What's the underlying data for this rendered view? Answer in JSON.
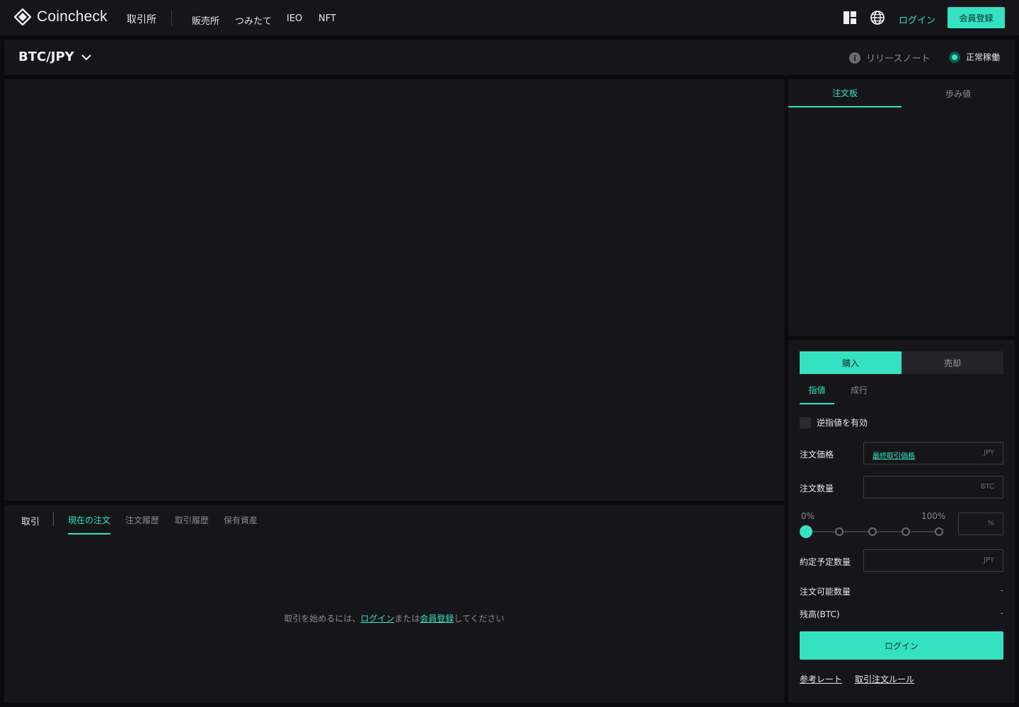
{
  "header": {
    "brand": "Coincheck",
    "main_nav": "取引所",
    "nav_items": [
      "販売所",
      "つみたて",
      "IEO",
      "NFT"
    ],
    "login": "ログイン",
    "register": "会員登録"
  },
  "pairbar": {
    "pair": "BTC/JPY",
    "release_notes": "リリースノート",
    "status": "正常稼働"
  },
  "orderbook": {
    "tabs": [
      "注文板",
      "歩み値"
    ],
    "active_tab": 0
  },
  "bottom": {
    "label": "取引",
    "tabs": [
      "現在の注文",
      "注文履歴",
      "取引履歴",
      "保有資産"
    ],
    "active_tab": 0,
    "message_prefix": "取引を始めるには、",
    "message_login": "ログイン",
    "message_mid": "または",
    "message_register": "会員登録",
    "message_suffix": "してください"
  },
  "order_form": {
    "buy": "購入",
    "sell": "売却",
    "order_types": [
      "指値",
      "成行"
    ],
    "stop_label": "逆指値を有効",
    "price_label": "注文価格",
    "price_link": "最終取引価格",
    "price_unit": "JPY",
    "amount_label": "注文数量",
    "amount_unit": "BTC",
    "pct_min": "0%",
    "pct_max": "100%",
    "pct_unit": "%",
    "pct_value": 0,
    "estimate_label": "約定予定数量",
    "estimate_unit": "JPY",
    "available_label": "注文可能数量",
    "available_value": "-",
    "balance_label": "残高(BTC)",
    "balance_value": "-",
    "login_button": "ログイン",
    "ref_rate": "参考レート",
    "rules": "取引注文ルール"
  },
  "colors": {
    "accent": "#34e2c2",
    "panel": "#16161a",
    "background": "#0b0b0d"
  }
}
